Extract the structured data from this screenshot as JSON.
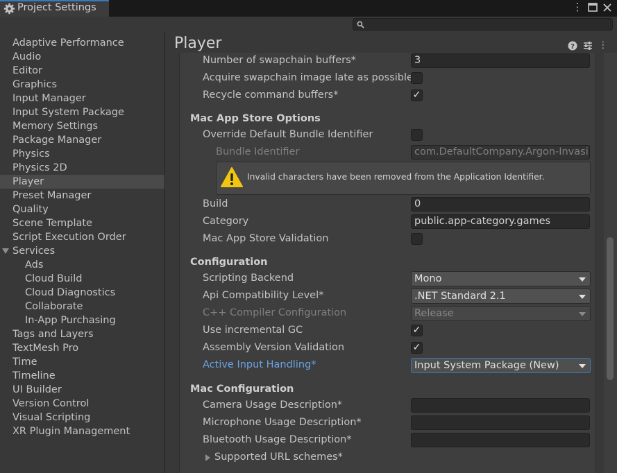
{
  "window": {
    "tab_title": "Project Settings",
    "icons": [
      "more-icon",
      "maximize-icon",
      "close-icon"
    ]
  },
  "search": {
    "placeholder": ""
  },
  "sidebar": {
    "items": [
      {
        "label": "Adaptive Performance",
        "level": 0
      },
      {
        "label": "Audio",
        "level": 0
      },
      {
        "label": "Editor",
        "level": 0
      },
      {
        "label": "Graphics",
        "level": 0
      },
      {
        "label": "Input Manager",
        "level": 0
      },
      {
        "label": "Input System Package",
        "level": 0
      },
      {
        "label": "Memory Settings",
        "level": 0
      },
      {
        "label": "Package Manager",
        "level": 0
      },
      {
        "label": "Physics",
        "level": 0
      },
      {
        "label": "Physics 2D",
        "level": 0
      },
      {
        "label": "Player",
        "level": 0,
        "selected": true
      },
      {
        "label": "Preset Manager",
        "level": 0
      },
      {
        "label": "Quality",
        "level": 0
      },
      {
        "label": "Scene Template",
        "level": 0
      },
      {
        "label": "Script Execution Order",
        "level": 0
      },
      {
        "label": "Services",
        "level": 0,
        "expanded": true
      },
      {
        "label": "Ads",
        "level": 1
      },
      {
        "label": "Cloud Build",
        "level": 1
      },
      {
        "label": "Cloud Diagnostics",
        "level": 1
      },
      {
        "label": "Collaborate",
        "level": 1
      },
      {
        "label": "In-App Purchasing",
        "level": 1
      },
      {
        "label": "Tags and Layers",
        "level": 0
      },
      {
        "label": "TextMesh Pro",
        "level": 0
      },
      {
        "label": "Time",
        "level": 0
      },
      {
        "label": "Timeline",
        "level": 0
      },
      {
        "label": "UI Builder",
        "level": 0
      },
      {
        "label": "Version Control",
        "level": 0
      },
      {
        "label": "Visual Scripting",
        "level": 0
      },
      {
        "label": "XR Plugin Management",
        "level": 0
      }
    ]
  },
  "main": {
    "title": "Player",
    "header_icons": [
      "help-icon",
      "presets-icon",
      "kebab-icon"
    ],
    "swapchain_label": "Number of swapchain buffers*",
    "swapchain_value": "3",
    "acquire_label": "Acquire swapchain image late as possible",
    "acquire_checked": false,
    "recycle_label": "Recycle command buffers*",
    "recycle_checked": true,
    "mac_app_store_section": "Mac App Store Options",
    "override_bundle_label": "Override Default Bundle Identifier",
    "override_bundle_checked": false,
    "bundle_id_label": "Bundle Identifier",
    "bundle_id_value": "com.DefaultCompany.Argon-Invasi",
    "warning_message": "Invalid characters have been removed from the Application Identifier.",
    "build_label": "Build",
    "build_value": "0",
    "category_label": "Category",
    "category_value": "public.app-category.games",
    "validation_label": "Mac App Store Validation",
    "validation_checked": false,
    "configuration_section": "Configuration",
    "scripting_backend_label": "Scripting Backend",
    "scripting_backend_value": "Mono",
    "api_level_label": "Api Compatibility Level*",
    "api_level_value": ".NET Standard 2.1",
    "cpp_config_label": "C++ Compiler Configuration",
    "cpp_config_value": "Release",
    "incremental_gc_label": "Use incremental GC",
    "incremental_gc_checked": true,
    "assembly_validation_label": "Assembly Version Validation",
    "assembly_validation_checked": true,
    "input_handling_label": "Active Input Handling*",
    "input_handling_value": "Input System Package (New)",
    "mac_config_section": "Mac Configuration",
    "camera_usage_label": "Camera Usage Description*",
    "camera_usage_value": "",
    "microphone_usage_label": "Microphone Usage Description*",
    "microphone_usage_value": "",
    "bluetooth_usage_label": "Bluetooth Usage Description*",
    "bluetooth_usage_value": "",
    "url_schemes_label": "Supported URL schemes*"
  },
  "colors": {
    "background": "#383838",
    "panel": "#3e3e3e",
    "accent": "#3a79bb",
    "link": "#6ba2e6",
    "warning": "#f2c511"
  }
}
